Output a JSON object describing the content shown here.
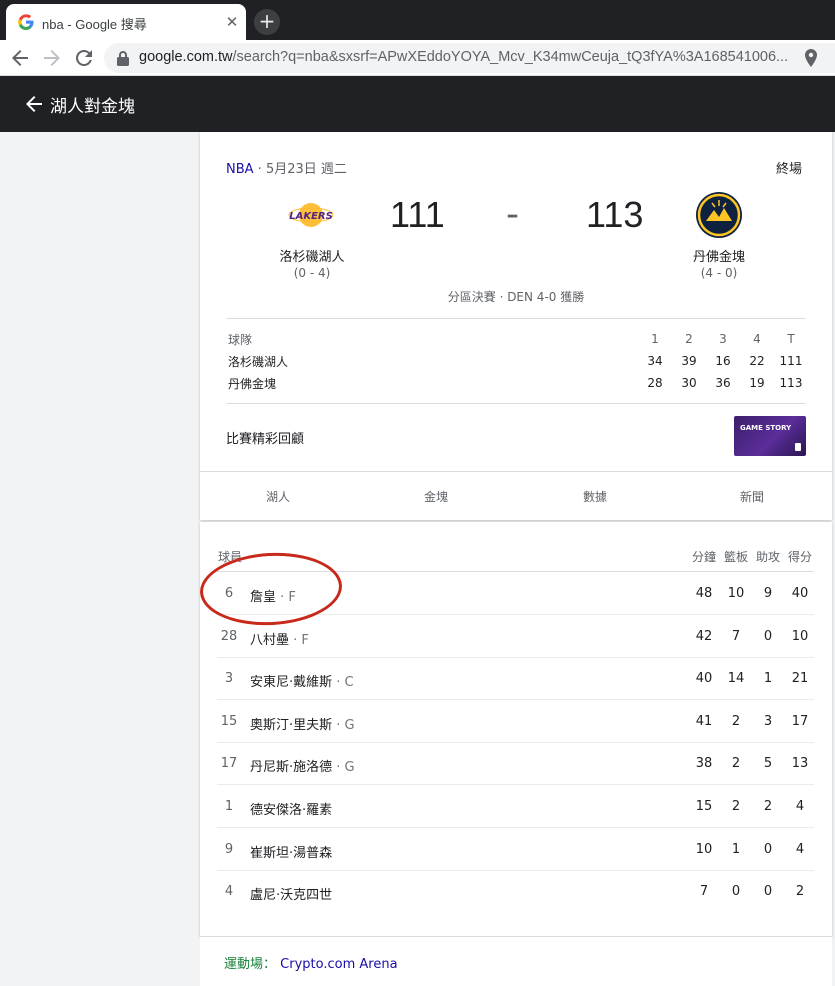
{
  "browser": {
    "tab_title": "nba - Google 搜尋",
    "tab_close": "✕",
    "new_tab": "+",
    "url_host": "google.com.tw",
    "url_path": "/search?q=nba&sxsrf=APwXEddoYOYA_Mcv_K34mwCeuja_tQ3fYA%3A168541006..."
  },
  "header": {
    "title": "湖人對金塊"
  },
  "game": {
    "league": "NBA",
    "date": " · 5月23日 週二",
    "status": "終場",
    "home": {
      "name": "洛杉磯湖人",
      "record": "(0 - 4)",
      "score": "111",
      "logo_text": "LAKERS",
      "color": "#552583"
    },
    "away": {
      "name": "丹佛金塊",
      "record": "(4 - 0)",
      "score": "113",
      "color": "#0e2240"
    },
    "dash": "-",
    "series": "分區決賽 · DEN 4-0 獲勝"
  },
  "linescore": {
    "header": [
      "球隊",
      "1",
      "2",
      "3",
      "4",
      "T"
    ],
    "rows": [
      [
        "洛杉磯湖人",
        "34",
        "39",
        "16",
        "22",
        "111"
      ],
      [
        "丹佛金塊",
        "28",
        "30",
        "36",
        "19",
        "113"
      ]
    ]
  },
  "highlights": {
    "label": "比賽精彩回顧",
    "thumb_text": "GAME STORY"
  },
  "tabs": [
    "湖人",
    "金塊",
    "數據",
    "新聞"
  ],
  "players": {
    "header": {
      "player": "球員",
      "min": "分鐘",
      "reb": "籃板",
      "ast": "助攻",
      "pts": "得分"
    },
    "rows": [
      {
        "num": "6",
        "name": "詹皇",
        "pos": " · F",
        "min": "48",
        "reb": "10",
        "ast": "9",
        "pts": "40"
      },
      {
        "num": "28",
        "name": "八村壘",
        "pos": " · F",
        "min": "42",
        "reb": "7",
        "ast": "0",
        "pts": "10"
      },
      {
        "num": "3",
        "name": "安東尼·戴維斯",
        "pos": " · C",
        "min": "40",
        "reb": "14",
        "ast": "1",
        "pts": "21"
      },
      {
        "num": "15",
        "name": "奧斯汀·里夫斯",
        "pos": " · G",
        "min": "41",
        "reb": "2",
        "ast": "3",
        "pts": "17"
      },
      {
        "num": "17",
        "name": "丹尼斯·施洛德",
        "pos": " · G",
        "min": "38",
        "reb": "2",
        "ast": "5",
        "pts": "13"
      },
      {
        "num": "1",
        "name": "德安傑洛·羅素",
        "pos": "",
        "min": "15",
        "reb": "2",
        "ast": "2",
        "pts": "4"
      },
      {
        "num": "9",
        "name": "崔斯坦·湯普森",
        "pos": "",
        "min": "10",
        "reb": "1",
        "ast": "0",
        "pts": "4"
      },
      {
        "num": "4",
        "name": "盧尼·沃克四世",
        "pos": "",
        "min": "7",
        "reb": "0",
        "ast": "0",
        "pts": "2"
      }
    ]
  },
  "venue": {
    "label": "運動場：",
    "name": "Crypto.com Arena"
  },
  "colors": {
    "highlight_circle": "#c7291a",
    "link": "#1a0dab",
    "header_bg": "#202124"
  }
}
